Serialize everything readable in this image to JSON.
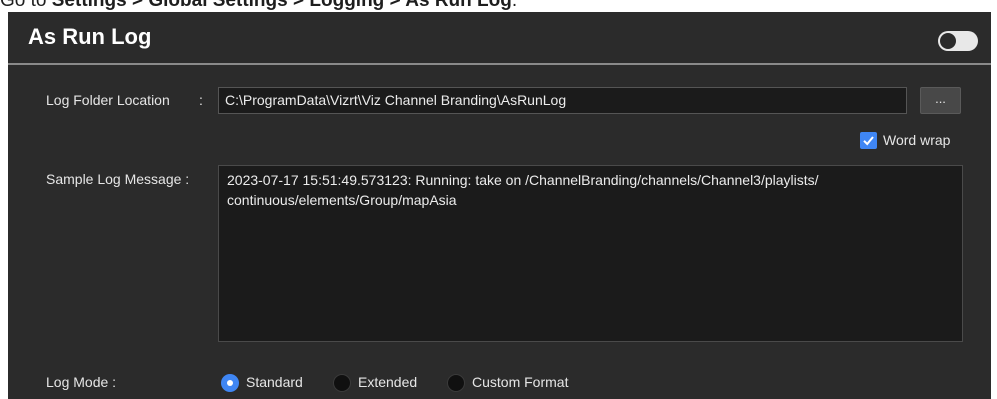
{
  "instruction": {
    "prefix": "Go to ",
    "path": [
      "Settings",
      "Global Settings",
      "Logging",
      "As Run Log"
    ],
    "separator": " > ",
    "suffix": "."
  },
  "panel": {
    "title": "As Run Log",
    "enabled": false
  },
  "log_folder": {
    "label": "Log Folder Location",
    "separator": ":",
    "value": "C:\\ProgramData\\Vizrt\\Viz Channel Branding\\AsRunLog",
    "browse_label": "..."
  },
  "word_wrap": {
    "label": "Word wrap",
    "checked": true
  },
  "sample": {
    "label": "Sample Log Message :",
    "line1": "2023-07-17 15:51:49.573123: Running: take on /ChannelBranding/channels/Channel3/playlists/",
    "line2": "continuous/elements/Group/mapAsia"
  },
  "log_mode": {
    "label": "Log Mode :",
    "options": [
      "Standard",
      "Extended",
      "Custom Format"
    ],
    "selected": "Standard"
  },
  "colors": {
    "panel_bg": "#2b2b2b",
    "field_bg": "#1b1b1b",
    "accent": "#3f86f4",
    "text": "#e6e6e6"
  }
}
